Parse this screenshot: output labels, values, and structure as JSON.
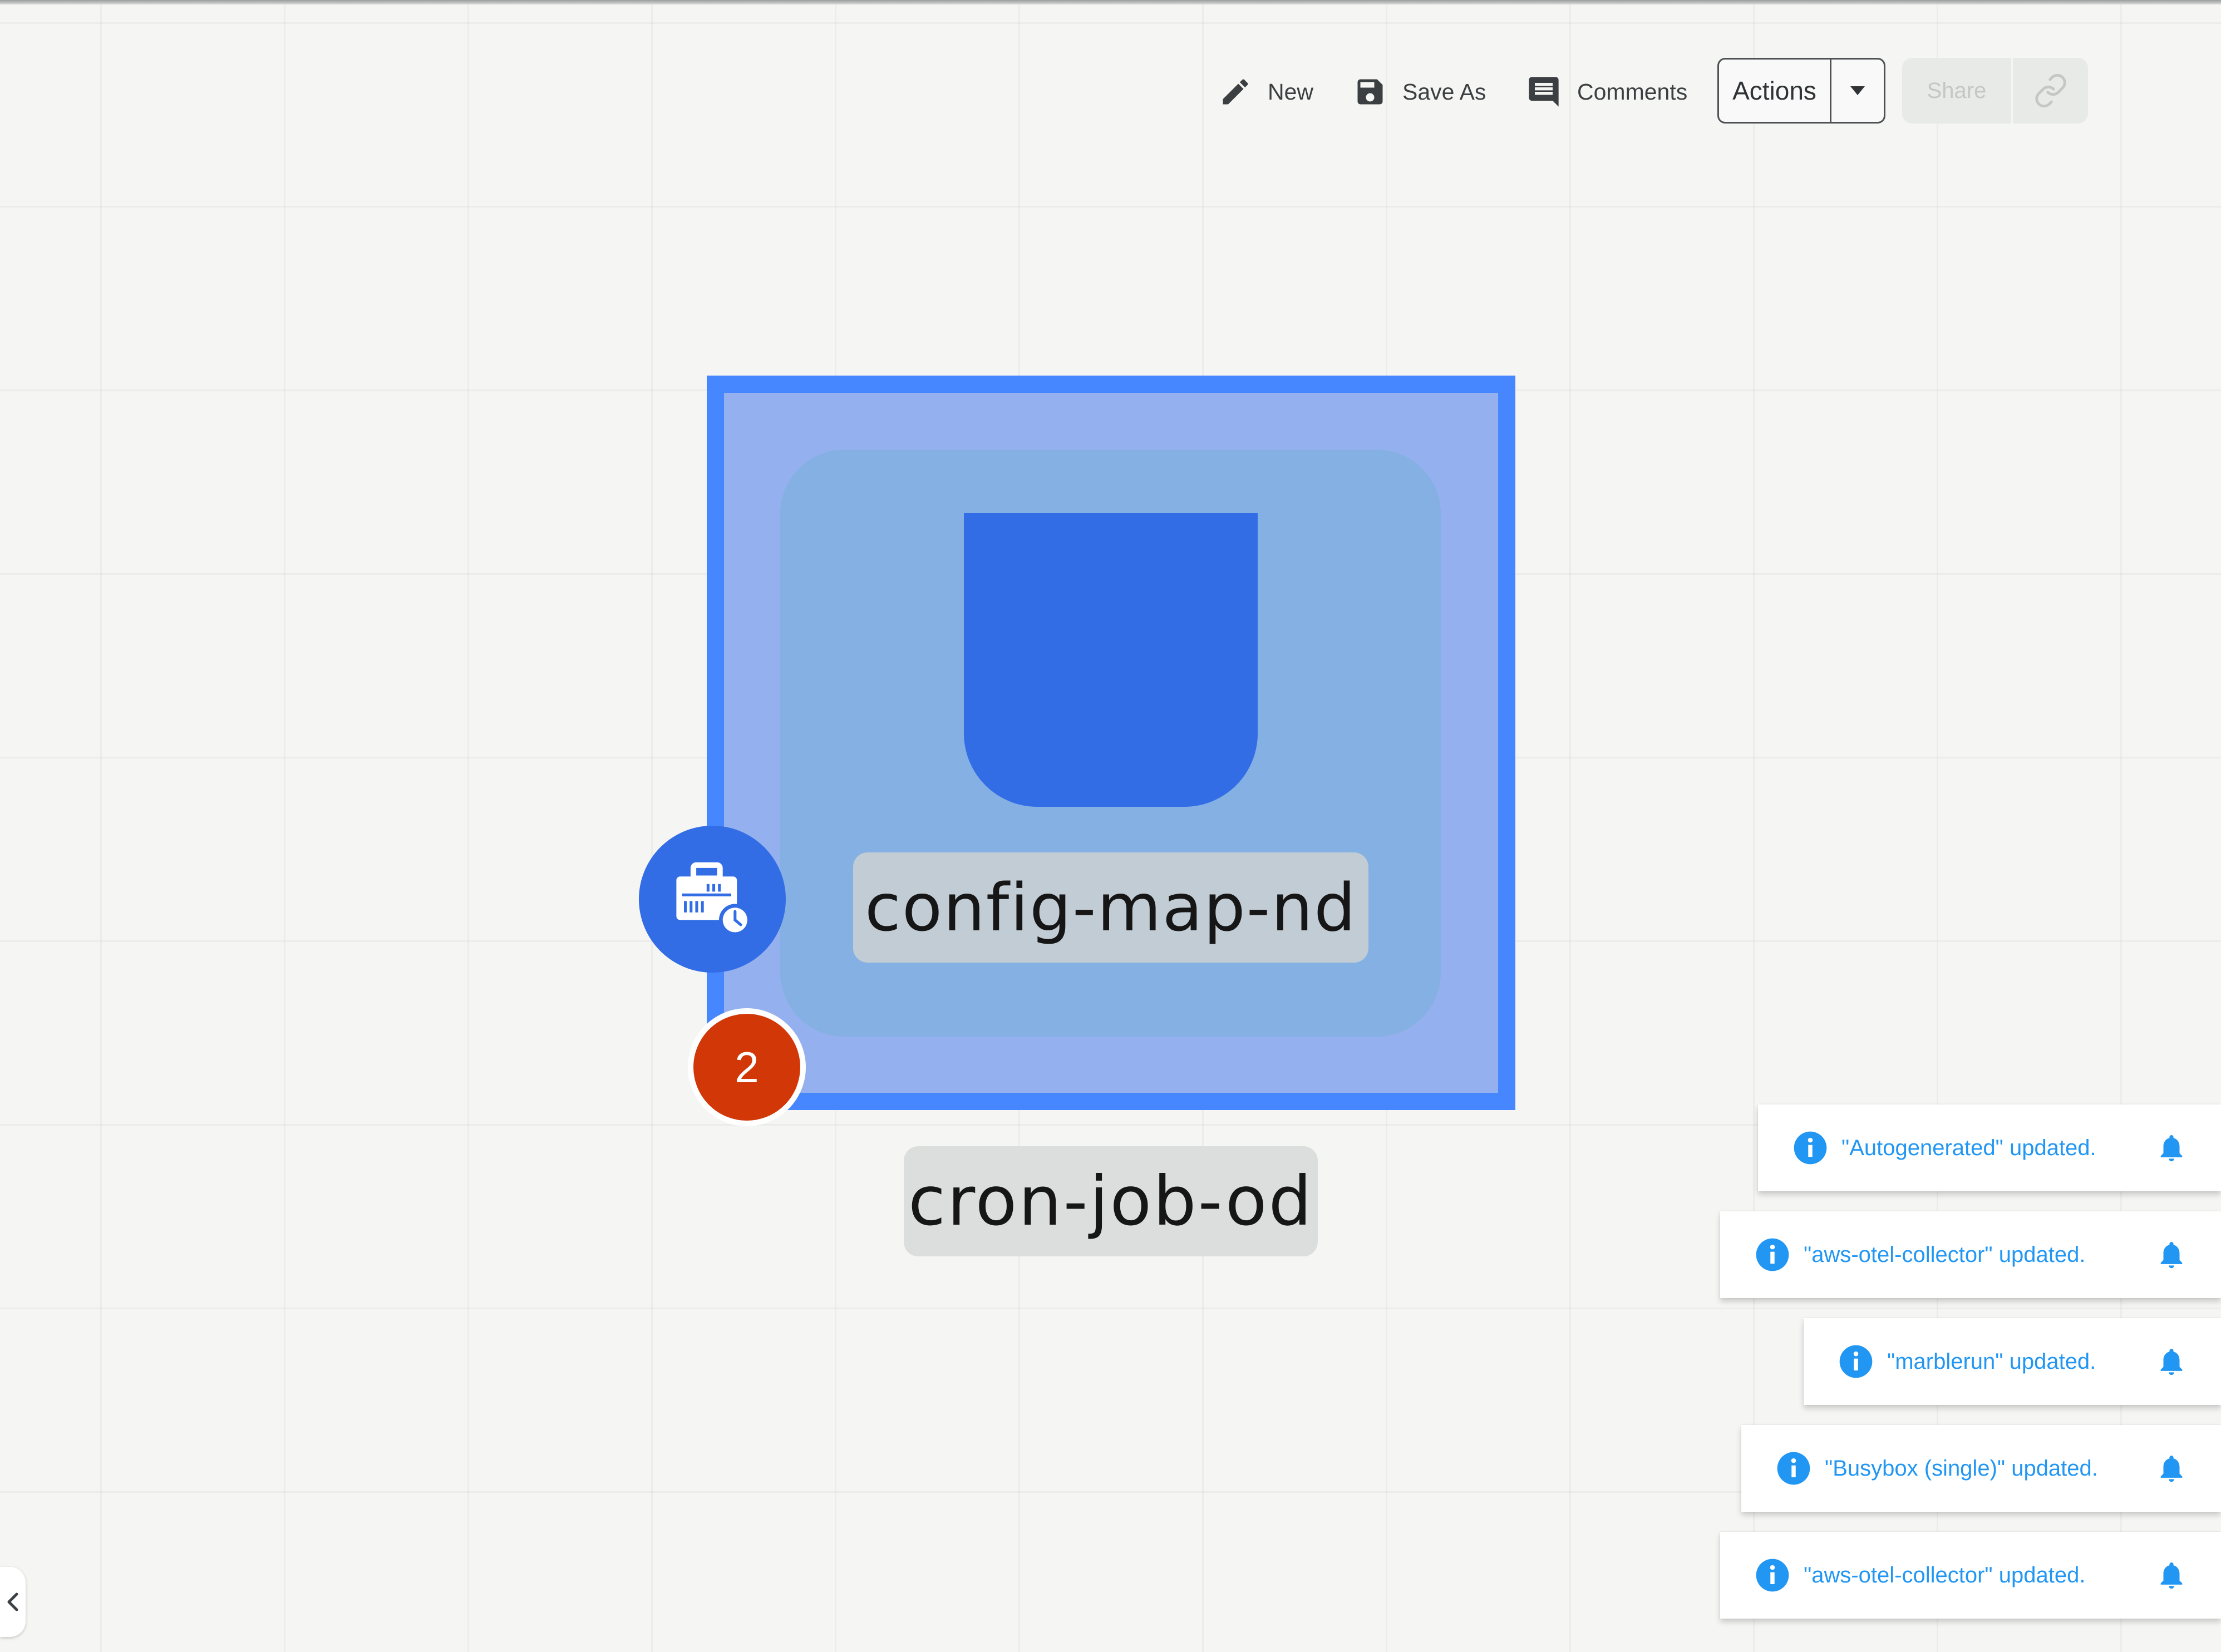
{
  "toolbar": {
    "new_label": "New",
    "save_as_label": "Save As",
    "comments_label": "Comments",
    "actions_label": "Actions",
    "share_label": "Share"
  },
  "node": {
    "inner_label": "config-map-nd",
    "label": "cron-job-od",
    "badge_count": "2",
    "colors": {
      "outer_border": "#4687ff",
      "outer_fill": "#95b0ee",
      "inner_fill": "#85b0e3",
      "shape_fill": "#326de6",
      "badge": "#d23708"
    }
  },
  "notifications": [
    {
      "text": "\"Autogenerated\" updated."
    },
    {
      "text": "\"aws-otel-collector\" updated."
    },
    {
      "text": "\"marblerun\" updated."
    },
    {
      "text": "\"Busybox (single)\" updated."
    },
    {
      "text": "\"aws-otel-collector\" updated."
    }
  ],
  "icons": {
    "new": "pencil-icon",
    "save_as": "floppy-disk-icon",
    "comments": "comment-icon",
    "actions_dropdown": "caret-down-icon",
    "share_link": "link-icon",
    "node_type": "cron-job-icon",
    "notification_info": "info-icon",
    "notification_bell": "bell-icon",
    "collapse": "chevron-left-icon"
  }
}
